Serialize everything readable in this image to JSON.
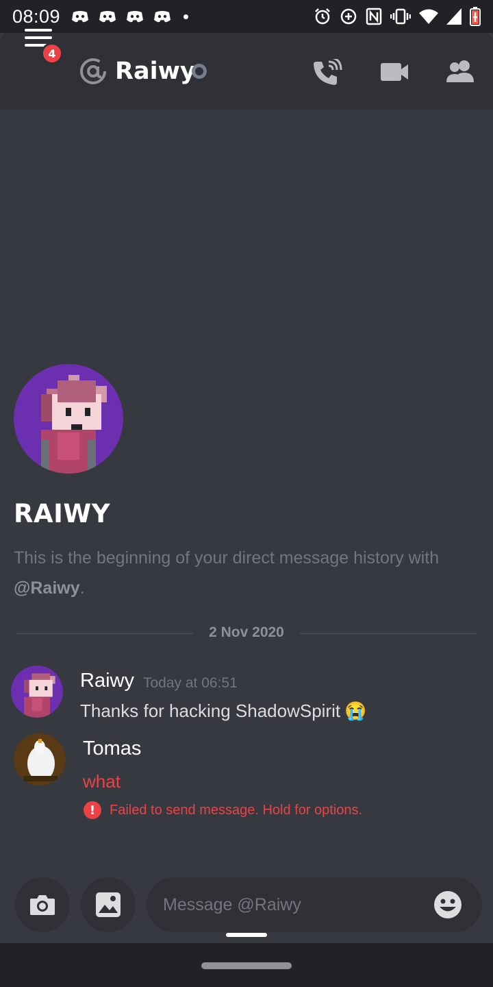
{
  "status_bar": {
    "time": "08:09"
  },
  "header": {
    "badge_count": "4",
    "title": "Raiwy"
  },
  "welcome": {
    "name": "RAIWY",
    "text_prefix": "This is the beginning of your direct message history with ",
    "mention": "@Raiwy",
    "text_suffix": "."
  },
  "divider": {
    "date": "2 Nov 2020"
  },
  "messages": [
    {
      "author": "Raiwy",
      "timestamp": "Today at 06:51",
      "text": "Thanks for hacking ShadowSpirit",
      "emoji": "😭"
    },
    {
      "author": "Tomas",
      "text": "what",
      "error": "Failed to send message. Hold for options."
    }
  ],
  "composer": {
    "placeholder": "Message @Raiwy"
  },
  "colors": {
    "background": "#36393f",
    "header": "#2f3136",
    "error": "#ed4245",
    "avatar_purple": "#6b2fb0"
  }
}
